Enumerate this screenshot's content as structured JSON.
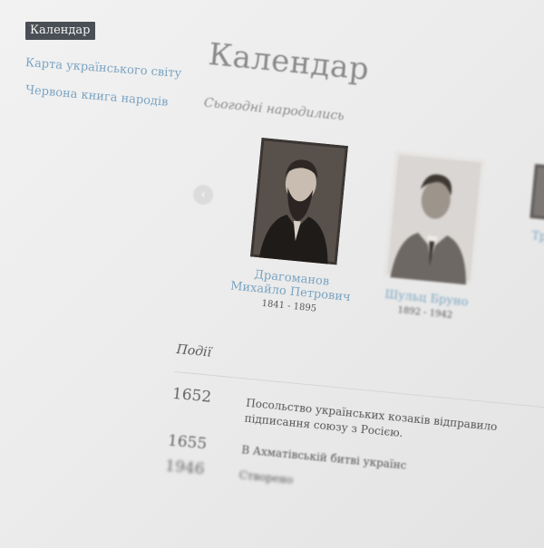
{
  "sidebar": {
    "items": [
      {
        "label": "Календар",
        "active": true
      },
      {
        "label": "Карта українського світу"
      },
      {
        "label": "Червона книга народів"
      }
    ]
  },
  "main": {
    "title": "Календар",
    "subtitle": "Сьогодні народились",
    "prev_icon": "chevron-left-icon",
    "people": [
      {
        "name_line1": "Драгоманов",
        "name_line2": "Михайло Петрович",
        "years": "1841 - 1895"
      },
      {
        "name_line1": "Шульц Бруно",
        "name_line2": "",
        "years": "1892 - 1942"
      },
      {
        "name_line1": "Труб",
        "name_line2": "",
        "years": ""
      }
    ],
    "events_title": "Події",
    "events": [
      {
        "year": "1652",
        "line1": "Посольство українських козаків відправило",
        "line2": "підписання союзу з Росією."
      },
      {
        "year": "1655",
        "line1": "В Ахматівській битві українс",
        "line2": ""
      },
      {
        "year": "1946",
        "line1": "Створено",
        "line2": ""
      },
      {
        "year": "",
        "line1": "",
        "line2": ""
      }
    ]
  },
  "colors": {
    "link": "#7aa4c2",
    "active_bg": "#4a4f55",
    "background": "#ececec"
  }
}
